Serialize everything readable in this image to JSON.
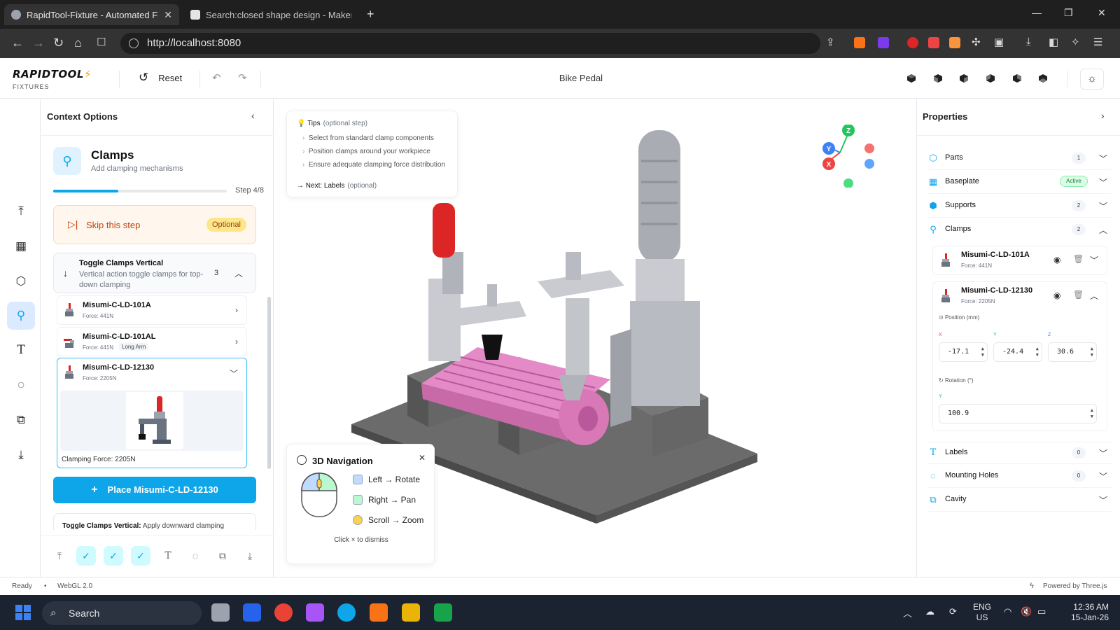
{
  "browser": {
    "tabs": [
      {
        "title": "RapidTool-Fixture - Automated F",
        "active": true
      },
      {
        "title": "Search:closed shape design - MakerW",
        "active": false
      }
    ],
    "url": "http://localhost:8080"
  },
  "app": {
    "logo": "RAPIDTOOL",
    "logo_sub": "FIXTURES",
    "reset_label": "Reset",
    "doc_title": "Bike Pedal"
  },
  "context": {
    "title": "Context Options",
    "step": {
      "title": "Clamps",
      "subtitle": "Add clamping mechanisms",
      "counter": "Step 4/8",
      "progress": 0.375
    },
    "skip": {
      "label": "Skip this step",
      "badge": "Optional"
    },
    "group": {
      "title": "Toggle Clamps Vertical",
      "desc": "Vertical action toggle clamps for top-down clamping",
      "count": "3"
    },
    "clamps": [
      {
        "name": "Misumi-C-LD-101A",
        "force": "Force: 441N",
        "tag": ""
      },
      {
        "name": "Misumi-C-LD-101AL",
        "force": "Force: 441N",
        "tag": "Long Arm"
      },
      {
        "name": "Misumi-C-LD-12130",
        "force": "Force: 2205N",
        "tag": ""
      }
    ],
    "clamping_force": "Clamping Force: 2205N",
    "place_button": "Place Misumi-C-LD-12130",
    "next_group_title": "Toggle Clamps Vertical:",
    "next_group_desc": "Apply downward clamping"
  },
  "tips": {
    "title": "Tips",
    "optional": "(optional step)",
    "items": [
      "Select from standard clamp components",
      "Position clamps around your workpiece",
      "Ensure adequate clamping force distribution"
    ],
    "next_label": "Next: Labels",
    "next_optional": "(optional)"
  },
  "nav_help": {
    "title": "3D Navigation",
    "items": [
      {
        "label": "Left → Rotate",
        "color": "#bfdbfe"
      },
      {
        "label": "Right → Pan",
        "color": "#bbf7d0"
      },
      {
        "label": "Scroll → Zoom",
        "color": "#fcd34d"
      }
    ],
    "dismiss": "Click × to dismiss"
  },
  "gizmo": {
    "x": "X",
    "y": "Y",
    "z": "Z"
  },
  "properties": {
    "title": "Properties",
    "sections": [
      {
        "label": "Parts",
        "count": "1"
      },
      {
        "label": "Baseplate",
        "badge": "Active"
      },
      {
        "label": "Supports",
        "count": "2"
      },
      {
        "label": "Clamps",
        "count": "2"
      },
      {
        "label": "Labels",
        "count": "0"
      },
      {
        "label": "Mounting Holes",
        "count": "0"
      },
      {
        "label": "Cavity"
      }
    ],
    "clamps": [
      {
        "name": "Misumi-C-LD-101A",
        "force": "Force: 441N"
      },
      {
        "name": "Misumi-C-LD-12130",
        "force": "Force: 2205N"
      }
    ],
    "position_label": "Position (mm)",
    "axis_x": "X",
    "axis_y": "Y",
    "axis_z": "Z",
    "pos_x": "-17.1",
    "pos_y": "-24.4",
    "pos_z": "30.6",
    "rotation_label": "Rotation (°)",
    "rot_axis": "Y",
    "rot_y": "100.9"
  },
  "status": {
    "state": "Ready",
    "renderer": "WebGL 2.0",
    "powered": "Powered by Three.js"
  },
  "taskbar": {
    "search": "Search",
    "lang": "ENG",
    "region": "US",
    "time": "12:36 AM",
    "date": "15-Jan-26"
  },
  "colors": {
    "accent": "#0ea5e9",
    "workpiece": "#e48ac7",
    "handle": "#dc2626",
    "baseplate": "#666666"
  }
}
